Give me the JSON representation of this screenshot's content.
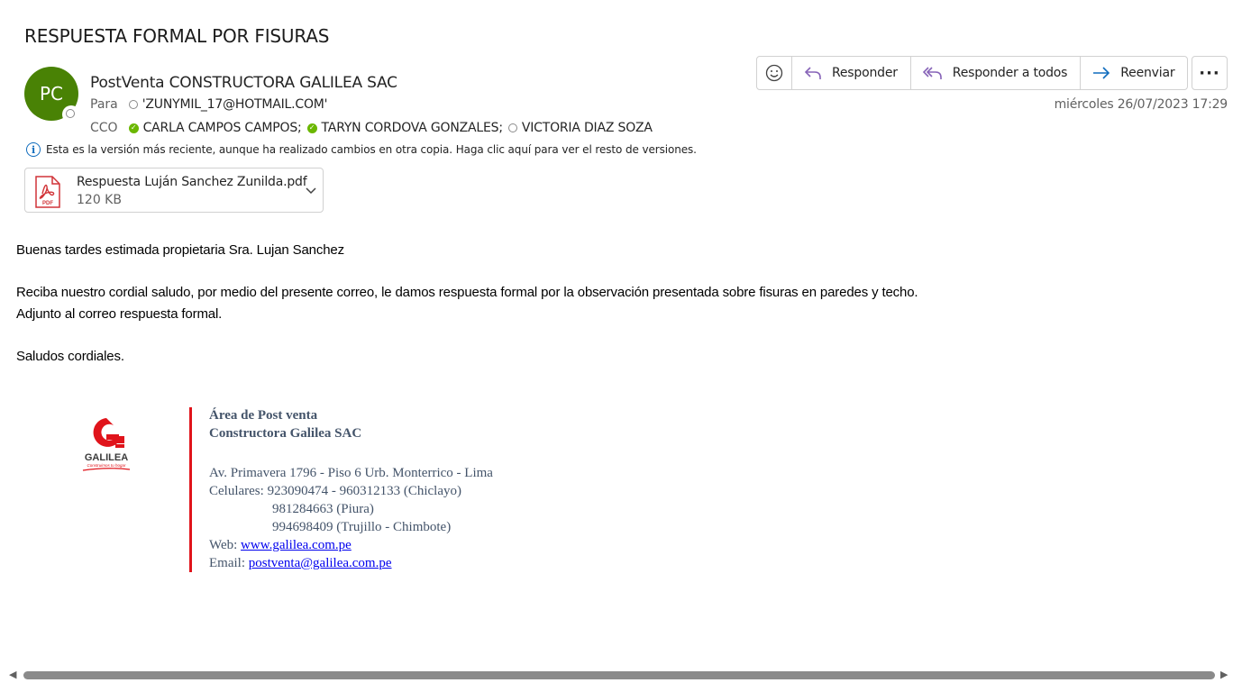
{
  "subject": "RESPUESTA FORMAL POR FISURAS",
  "sender": {
    "initials": "PC",
    "name": "PostVenta CONSTRUCTORA GALILEA SAC",
    "avatar_color": "#498205"
  },
  "to": {
    "label": "Para",
    "recipients": [
      {
        "name": "'ZUNYMIL_17@HOTMAIL.COM'",
        "status": "unknown"
      }
    ]
  },
  "bcc": {
    "label": "CCO",
    "recipients": [
      {
        "name": "CARLA CAMPOS CAMPOS;",
        "status": "available"
      },
      {
        "name": "TARYN CORDOVA GONZALES;",
        "status": "available"
      },
      {
        "name": "VICTORIA DIAZ SOZA",
        "status": "unknown"
      }
    ]
  },
  "info_notice": "Esta es la versión más reciente, aunque ha realizado cambios en otra copia. Haga clic aquí para ver el resto de versiones.",
  "attachment": {
    "filename": "Respuesta Luján Sanchez Zunilda.pdf",
    "size": "120 KB",
    "icon": "pdf-icon"
  },
  "toolbar": {
    "reply_label": "Responder",
    "reply_all_label": "Responder a todos",
    "forward_label": "Reenviar",
    "emoji_icon": "smiley-icon",
    "more_icon": "more-icon"
  },
  "date": "miércoles 26/07/2023 17:29",
  "body": {
    "greeting": "Buenas tardes estimada propietaria Sra. Lujan Sanchez",
    "paragraph1": "Reciba nuestro cordial saludo, por medio del presente correo, le damos respuesta formal por la observación presentada sobre fisuras en paredes y techo.",
    "paragraph2": "Adjunto al correo respuesta formal.",
    "closing": "Saludos cordiales."
  },
  "signature": {
    "logo_text": "GALILEA",
    "logo_tagline": "Construimos tu hogar",
    "line1": "Área de Post venta",
    "line2": "Constructora Galilea SAC",
    "address": "Av. Primavera 1796 - Piso 6 Urb. Monterrico - Lima",
    "phones_label": "Celulares:",
    "phone1": "923090474 - 960312133 (Chiclayo)",
    "phone2": "981284663 (Piura)",
    "phone3": "994698409 (Trujillo - Chimbote)",
    "web_label": "Web:",
    "web": "www.galilea.com.pe",
    "email_label": "Email:",
    "email": "postventa@galilea.com.pe",
    "accent_color": "#e0141b"
  }
}
